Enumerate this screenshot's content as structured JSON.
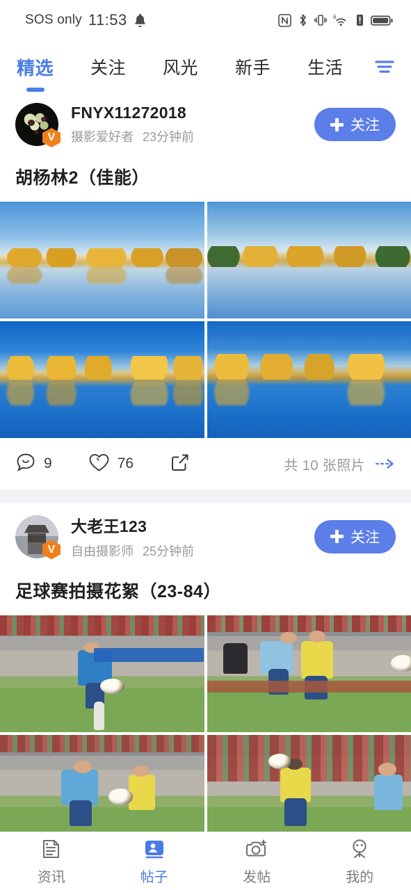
{
  "statusbar": {
    "carrier": "SOS only",
    "time": "11:53",
    "icons": [
      "bell-icon",
      "nfc-icon",
      "bluetooth-icon",
      "vibrate-icon",
      "wifi-6-icon",
      "signal-alert-icon",
      "battery-icon"
    ]
  },
  "tabs": [
    {
      "label": "精选",
      "active": true
    },
    {
      "label": "关注",
      "active": false
    },
    {
      "label": "风光",
      "active": false
    },
    {
      "label": "新手",
      "active": false
    },
    {
      "label": "生活",
      "active": false
    }
  ],
  "tab_actions": {
    "menu": "menu-icon",
    "search": "search-icon"
  },
  "posts": [
    {
      "username": "FNYX11272018",
      "role": "摄影爱好者",
      "time": "23分钟前",
      "badge": "V",
      "follow_label": "关注",
      "title": "胡杨林2（佳能）",
      "comments": "9",
      "likes": "76",
      "share": "share-icon",
      "photo_count": "共 10 张照片"
    },
    {
      "username": "大老王123",
      "role": "自由摄影师",
      "time": "25分钟前",
      "badge": "V",
      "follow_label": "关注",
      "title": "足球赛拍摄花絮（23-84）"
    }
  ],
  "bottom_nav": [
    {
      "label": "资讯",
      "icon": "news-icon",
      "active": false
    },
    {
      "label": "帖子",
      "icon": "posts-icon",
      "active": true
    },
    {
      "label": "发帖",
      "icon": "camera-add-icon",
      "active": false
    },
    {
      "label": "我的",
      "icon": "profile-icon",
      "active": false
    }
  ],
  "colors": {
    "accent": "#4a7ce8",
    "follow_button": "#5b7ee8",
    "badge": "#f0801e",
    "separator": "#f0f2f5"
  }
}
